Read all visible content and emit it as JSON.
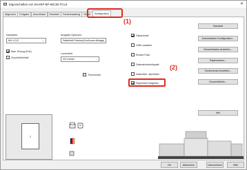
{
  "window": {
    "title": "Eigenschaften von SHARP BP-90C80 PCL6",
    "close": "✕"
  },
  "tabs": [
    {
      "label": "Allgemein"
    },
    {
      "label": "Freigabe"
    },
    {
      "label": "Anschlüsse"
    },
    {
      "label": "Erweitert"
    },
    {
      "label": "Farbverwaltung"
    },
    {
      "label": "Sicher"
    },
    {
      "label": "Konfiguration",
      "active": true
    }
  ],
  "left": {
    "kassetten_label": "Kassetten:",
    "kassetten_value": "MX-LC12",
    "ausgabe_label": "Ausgabe-Optionen:",
    "ausgabe_value": "Sattelheft-Finisher(Großraum-Ablage)",
    "locher_label": "Locherfinit:",
    "locher_value": "2/4 Löcher",
    "opt1_label": "Man. Einzug (Fuß)",
    "opt1_checked": true,
    "opt2_label": "Zuschießeinheit",
    "opt2_checked": false,
    "opt3_label": "Trennmodul",
    "opt3_checked": false
  },
  "mid": {
    "cb1_label": "Faltseinheit",
    "cb1_checked": true,
    "cb2_label": "USB-Laufwerk",
    "cb2_checked": false,
    "cb3_label": "Rechte Fach",
    "cb3_checked": false,
    "cb4_label": "Datensicherheitspakt",
    "cb4_checked": false,
    "cb5_label": "Dateneinh. abmelden",
    "cb5_checked": false,
    "cb6_label": "Papierfach freigeben",
    "cb6_checked": true
  },
  "right_buttons": [
    {
      "label": "Standard"
    },
    {
      "label": "Automatische Konfiguration..."
    },
    {
      "label": "Schachtstatus einstellen..."
    },
    {
      "label": "Papiernamen..."
    },
    {
      "label": "Tonderdruck einstellen..."
    },
    {
      "label": "Druckrichtlinie..."
    }
  ],
  "info_button": "Info",
  "callouts": {
    "one": "(1)",
    "two": "(2)"
  },
  "preview": {
    "page_number": "1"
  },
  "footer": {
    "ok": "OK",
    "cancel": "Abbrechen",
    "apply": "Übernehmen",
    "help": "Hilfe"
  },
  "colors": {
    "highlight": "#e0271f"
  },
  "icons": [
    "printer-icon",
    "staple-icon",
    "color-icon",
    "machine-illustration"
  ]
}
